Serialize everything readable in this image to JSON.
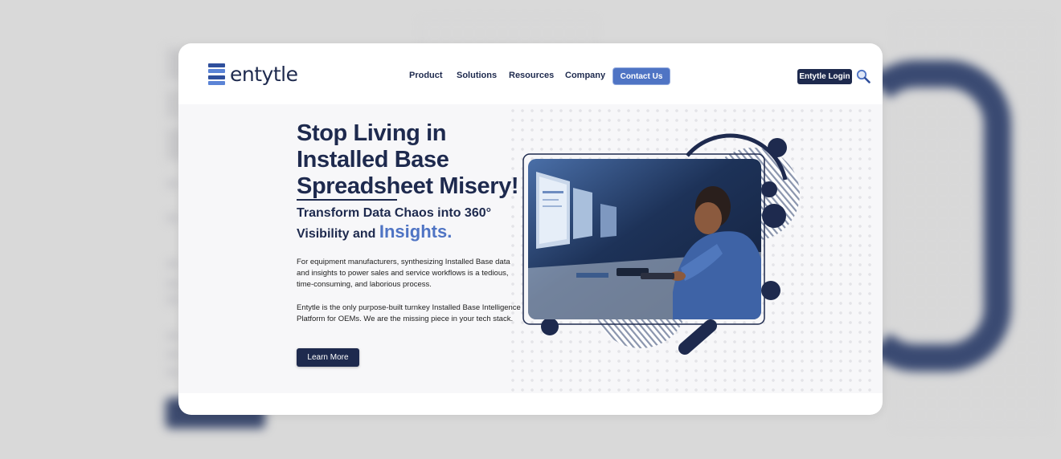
{
  "brand": {
    "name": "entytle",
    "logo_colors": [
      "#2f4f9c",
      "#5b84d6",
      "#2f4f9c",
      "#5b84d6"
    ]
  },
  "nav": {
    "items": [
      {
        "label": "Product"
      },
      {
        "label": "Solutions"
      },
      {
        "label": "Resources"
      },
      {
        "label": "Company"
      }
    ],
    "contact_label": "Contact Us",
    "login_label": "Entytle Login",
    "search_icon": "search-icon"
  },
  "hero": {
    "headline_lines": [
      "Stop Living in",
      "Installed Base",
      "Spreadsheet Misery!"
    ],
    "subhead_line1": "Transform Data Chaos into 360°",
    "subhead_line2": "Visibility and",
    "subhead_emphasis": "Insights.",
    "paragraph1": "For equipment manufacturers, synthesizing Installed Base data and insights to power sales and service workflows is a tedious, time-consuming, and laborious process.",
    "paragraph2": "Entytle is the only purpose-built turnkey Installed Base Intelligence Platform for OEMs. We are the missing piece in your tech stack.",
    "cta_label": "Learn More"
  },
  "colors": {
    "navy": "#1e2a4e",
    "accent": "#4f74c4",
    "photo_bg": "#1c2c48"
  }
}
